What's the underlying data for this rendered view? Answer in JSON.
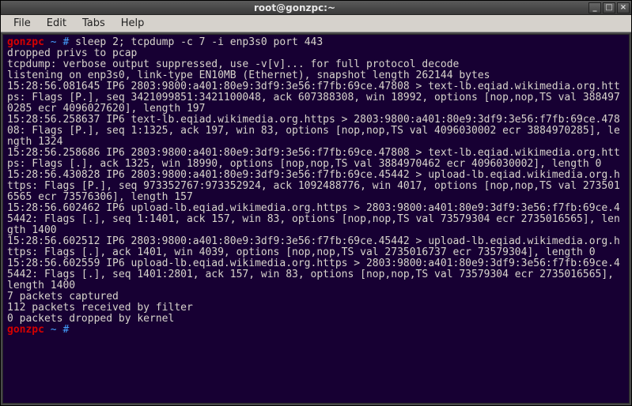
{
  "titlebar": {
    "title": "root@gonzpc:~",
    "min": "_",
    "max": "□",
    "close": "×"
  },
  "menubar": {
    "file": "File",
    "edit": "Edit",
    "tabs": "Tabs",
    "help": "Help"
  },
  "prompt1": {
    "host": "gonzpc",
    "tilde": "~",
    "hash": "#",
    "cmd": " sleep 2; tcpdump -c 7 -i enp3s0 port 443"
  },
  "output": "dropped privs to pcap\ntcpdump: verbose output suppressed, use -v[v]... for full protocol decode\nlistening on enp3s0, link-type EN10MB (Ethernet), snapshot length 262144 bytes\n15:28:56.081645 IP6 2803:9800:a401:80e9:3df9:3e56:f7fb:69ce.47808 > text-lb.eqiad.wikimedia.org.https: Flags [P.], seq 3421099851:3421100048, ack 607388308, win 18992, options [nop,nop,TS val 3884970285 ecr 4096027620], length 197\n15:28:56.258637 IP6 text-lb.eqiad.wikimedia.org.https > 2803:9800:a401:80e9:3df9:3e56:f7fb:69ce.47808: Flags [P.], seq 1:1325, ack 197, win 83, options [nop,nop,TS val 4096030002 ecr 3884970285], length 1324\n15:28:56.258686 IP6 2803:9800:a401:80e9:3df9:3e56:f7fb:69ce.47808 > text-lb.eqiad.wikimedia.org.https: Flags [.], ack 1325, win 18990, options [nop,nop,TS val 3884970462 ecr 4096030002], length 0\n15:28:56.430828 IP6 2803:9800:a401:80e9:3df9:3e56:f7fb:69ce.45442 > upload-lb.eqiad.wikimedia.org.https: Flags [P.], seq 973352767:973352924, ack 1092488776, win 4017, options [nop,nop,TS val 2735016565 ecr 73576306], length 157\n15:28:56.602462 IP6 upload-lb.eqiad.wikimedia.org.https > 2803:9800:a401:80e9:3df9:3e56:f7fb:69ce.45442: Flags [.], seq 1:1401, ack 157, win 83, options [nop,nop,TS val 73579304 ecr 2735016565], length 1400\n15:28:56.602512 IP6 2803:9800:a401:80e9:3df9:3e56:f7fb:69ce.45442 > upload-lb.eqiad.wikimedia.org.https: Flags [.], ack 1401, win 4039, options [nop,nop,TS val 2735016737 ecr 73579304], length 0\n15:28:56.602559 IP6 upload-lb.eqiad.wikimedia.org.https > 2803:9800:a401:80e9:3df9:3e56:f7fb:69ce.45442: Flags [.], seq 1401:2801, ack 157, win 83, options [nop,nop,TS val 73579304 ecr 2735016565], length 1400\n7 packets captured\n112 packets received by filter\n0 packets dropped by kernel",
  "prompt2": {
    "host": "gonzpc",
    "tilde": "~",
    "hash": "#"
  }
}
